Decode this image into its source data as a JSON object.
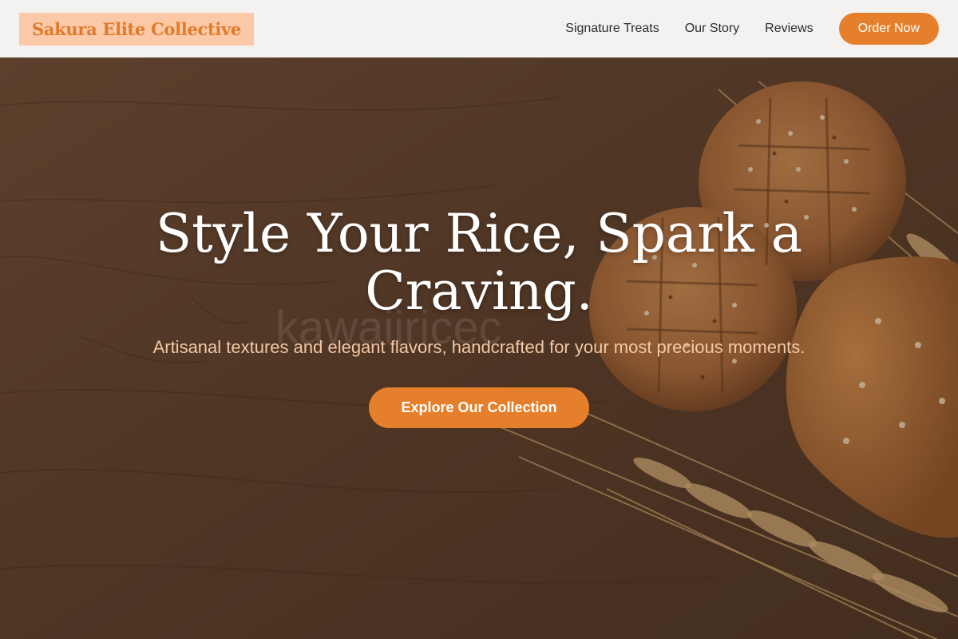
{
  "header": {
    "logo": "Sakura Elite Collective",
    "nav": [
      "Signature Treats",
      "Our Story",
      "Reviews"
    ],
    "cta": "Order Now"
  },
  "hero": {
    "title": "Style Your Rice, Spark a Craving.",
    "subtitle": "Artisanal textures and elegant flavors, handcrafted for your most precious moments.",
    "cta": "Explore Our Collection",
    "watermark": "kawaiiricec"
  },
  "colors": {
    "accent": "#e57f2b",
    "logo_bg": "#fbc8a8",
    "header_bg": "#f4f2f0",
    "subtitle": "#f3c8a6"
  }
}
